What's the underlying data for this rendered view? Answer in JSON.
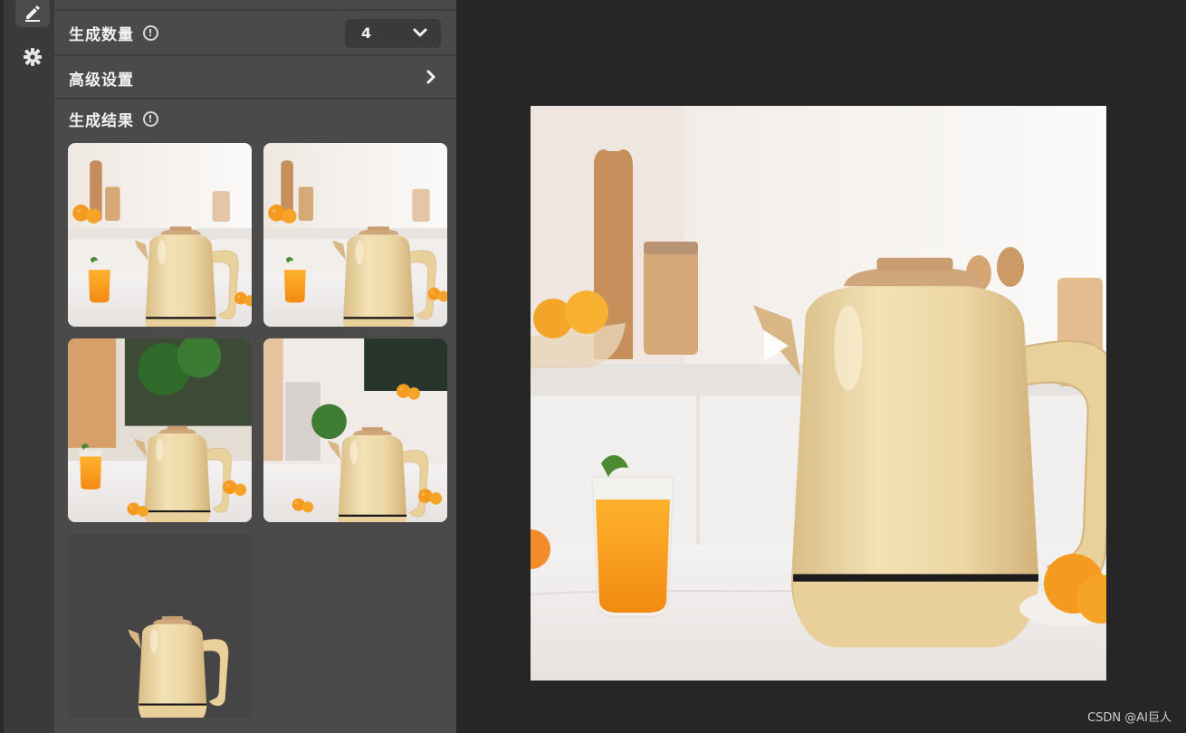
{
  "sidebar": {
    "items": [
      {
        "icon": "edit-icon",
        "active": true
      },
      {
        "icon": "gear-icon",
        "active": false
      }
    ]
  },
  "panel": {
    "count_label": "生成数量",
    "count_value": "4",
    "advanced_label": "高级设置",
    "results_label": "生成结果",
    "result_thumbnails": 5
  },
  "watermark": "CSDN @AI巨人",
  "colors": {
    "background": "#262626",
    "panel": "#4a4a4a",
    "rail": "#3a3a3a",
    "kettle": "#ecd7a4",
    "orange": "#f39a1f"
  }
}
